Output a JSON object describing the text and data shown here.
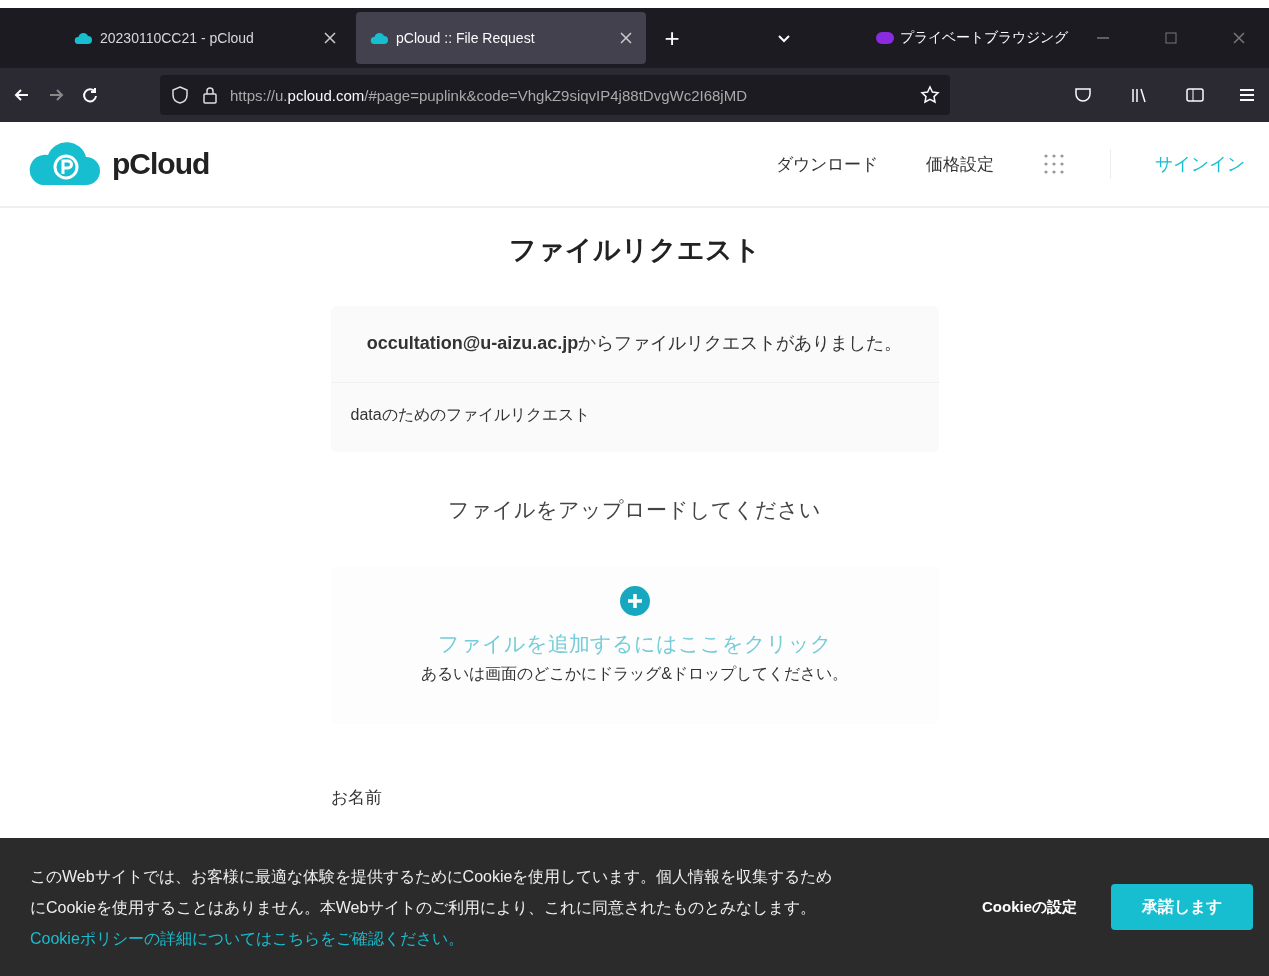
{
  "browser": {
    "tabs": [
      {
        "title": "20230110CC21 - pCloud",
        "selected": false
      },
      {
        "title": "pCloud :: File Request",
        "selected": true
      }
    ],
    "new_tab": "+",
    "private_label": "プライベートブラウジング",
    "url": {
      "prefix": "https://u.",
      "domain": "pcloud.com",
      "rest": "/#page=puplink&code=VhgkZ9siqvIP4j88tDvgWc2I68jMD"
    }
  },
  "header": {
    "logo": "pCloud",
    "nav": [
      "ダウンロード",
      "価格設定"
    ],
    "signin": "サインイン"
  },
  "main": {
    "title": "ファイルリクエスト",
    "request": {
      "message": "**occultation@u-aizu.ac.jp**からファイルリクエストがありました。",
      "description": "dataのためのファイルリクエスト"
    },
    "upload_prompt": "ファイルをアップロードしてください",
    "dropzone": {
      "link": "ファイルを追加するにはここをクリック",
      "hint": "あるいは画面のどこかにドラッグ&ドロップしてください。"
    },
    "name_label": "お名前"
  },
  "cookie": {
    "text": "このWebサイトでは、お客様に最適な体験を提供するためにCookieを使用しています。個人情報を収集するためにCookieを使用することはありません。本Webサイトのご利用により、これに同意されたものとみなします。",
    "link": "Cookieポリシーの詳細についてはこちらをご確認ください。",
    "settings_button": "Cookieの設定",
    "accept_button": "承諾します"
  }
}
